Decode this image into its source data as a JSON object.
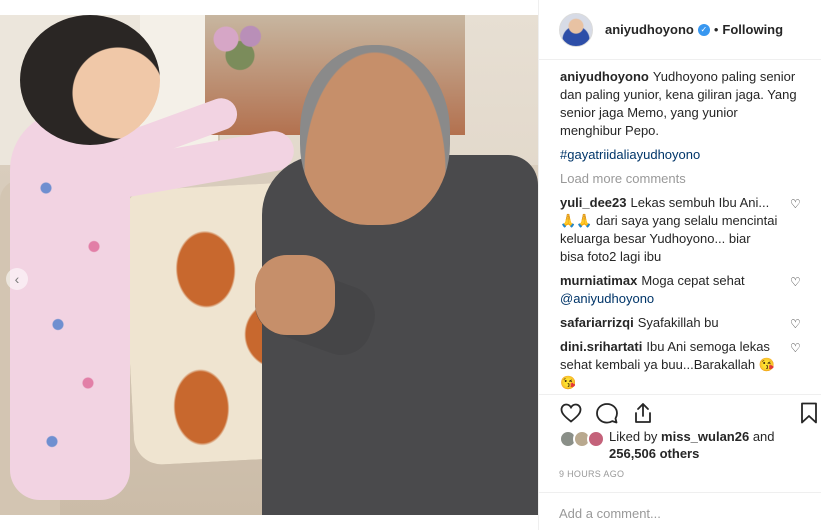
{
  "header": {
    "username": "aniyudhoyono",
    "dot": "•",
    "follow_status": "Following"
  },
  "caption": {
    "username": "aniyudhoyono",
    "text": "Yudhoyono paling senior dan paling yunior, kena giliran jaga. Yang senior jaga Memo, yang yunior menghibur Pepo.",
    "hashtag": "#gayatriidaliayudhoyono"
  },
  "load_more": "Load more comments",
  "comments": [
    {
      "username": "yuli_dee23",
      "text": "Lekas sembuh Ibu Ani... 🙏🙏 dari saya yang selalu mencintai keluarga besar Yudhoyono... biar bisa foto2 lagi ibu"
    },
    {
      "username": "murniatimax",
      "text": "Moga cepat sehat",
      "mention": "@aniyudhoyono"
    },
    {
      "username": "safariarrizqi",
      "text": "Syafakillah bu"
    },
    {
      "username": "dini.srihartati",
      "text": "Ibu Ani semoga lekas sehat kembali ya buu...Barakallah 😘😘"
    }
  ],
  "likes": {
    "prefix": "Liked by",
    "first_user": "miss_wulan26",
    "connector": "and",
    "count_text": "256,506 others"
  },
  "timestamp": "9 HOURS AGO",
  "add_comment": {
    "placeholder": "Add a comment..."
  },
  "carousel": {
    "arrow": "‹"
  },
  "icons": {
    "verified": "verified-badge-icon",
    "like": "heart-icon",
    "comment": "comment-bubble-icon",
    "share": "share-icon",
    "save": "bookmark-icon"
  },
  "colors": {
    "link": "#003569",
    "muted": "#999999",
    "verified": "#3897f0"
  }
}
